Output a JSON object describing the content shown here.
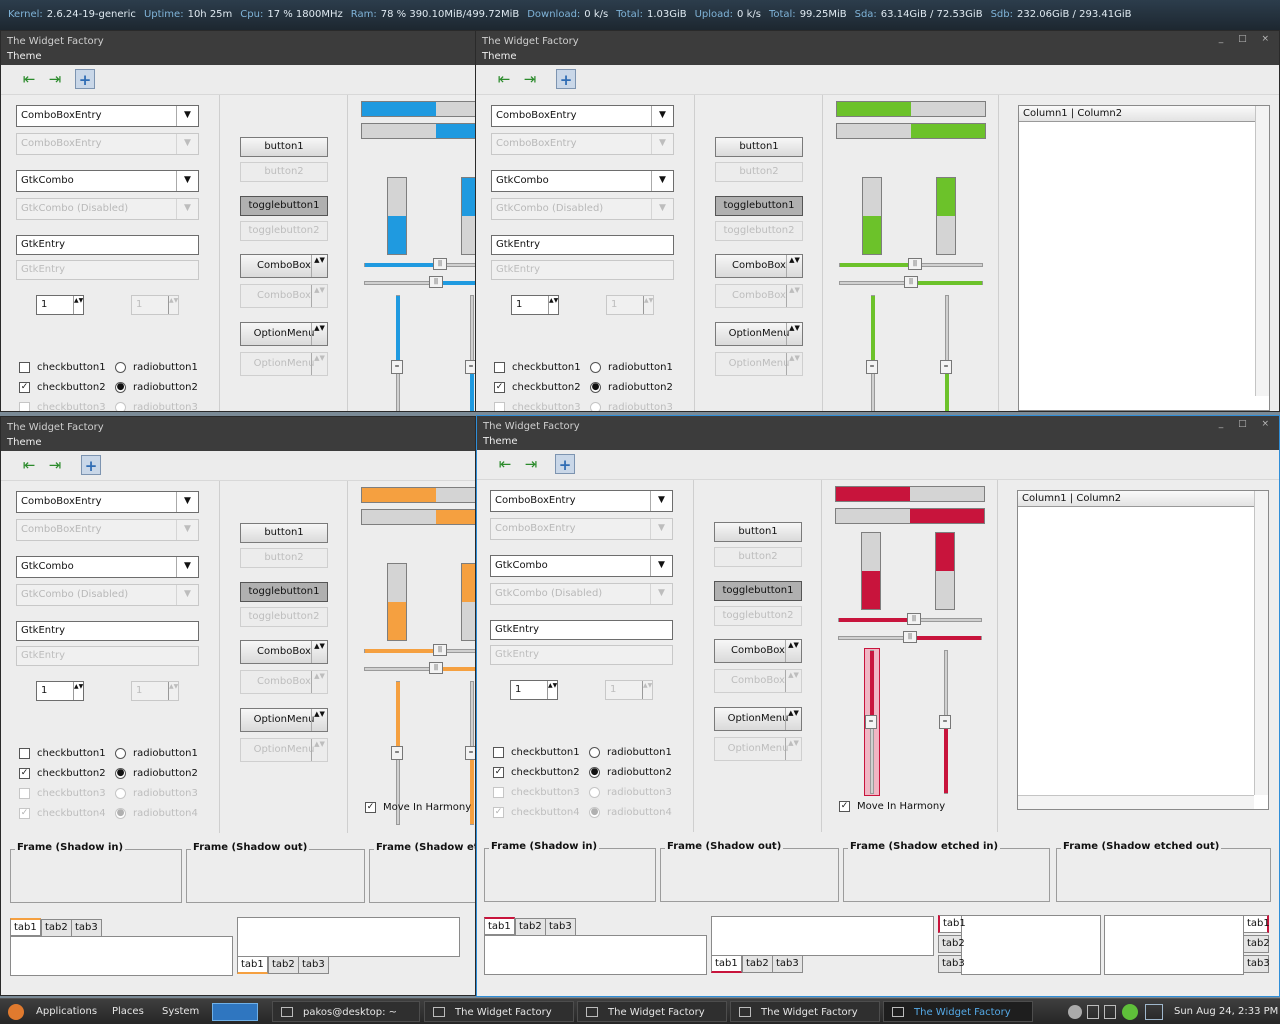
{
  "conky": [
    {
      "label": "Kernel:",
      "value": "2.6.24-19-generic"
    },
    {
      "label": "Uptime:",
      "value": "10h 25m"
    },
    {
      "label": "Cpu:",
      "value": "17 % 1800MHz"
    },
    {
      "label": "Ram:",
      "value": "78 %  390.10MiB/499.72MiB"
    },
    {
      "label": "Download:",
      "value": "0   k/s"
    },
    {
      "label": "Total:",
      "value": "1.03GiB"
    },
    {
      "label": "Upload:",
      "value": "0   k/s"
    },
    {
      "label": "Total:",
      "value": "99.25MiB"
    },
    {
      "label": "Sda:",
      "value": "63.14GiB  / 72.53GiB"
    },
    {
      "label": "Sdb:",
      "value": "232.06GiB / 293.41GiB"
    }
  ],
  "app": {
    "title": "The Widget Factory",
    "menu": "Theme",
    "window_buttons": "_ □ ×"
  },
  "w": {
    "combo_entry": "ComboBoxEntry",
    "gtk_combo": "GtkCombo",
    "gtk_combo_disabled": "GtkCombo (Disabled)",
    "entry": "GtkEntry",
    "spin_value": "1",
    "check1": "checkbutton1",
    "check2": "checkbutton2",
    "check3": "checkbutton3",
    "check4": "checkbutton4",
    "radio1": "radiobutton1",
    "radio2": "radiobutton2",
    "radio3": "radiobutton3",
    "radio4": "radiobutton4",
    "button1": "button1",
    "button2": "button2",
    "toggle1": "togglebutton1",
    "toggle2": "togglebutton2",
    "combobox": "ComboBox",
    "optionmenu": "OptionMenu",
    "col1": "Column1",
    "col2": "Column2",
    "harmony": "Move In Harmony",
    "frame_in": "Frame (Shadow in)",
    "frame_out": "Frame (Shadow out)",
    "frame_etched_in": "Frame (Shadow etched in)",
    "frame_etched_out": "Frame (Shadow etched out)",
    "frame_etched_trunc": "Frame (Shadow etche",
    "tab1": "tab1",
    "tab2": "tab2",
    "tab3": "tab3",
    "check": "✓",
    "radio_dot": "●",
    "arrow": "▼",
    "updown": "▲▼"
  },
  "accents": {
    "blue": "#1f9ae0",
    "green": "#6cc22a",
    "orange": "#f5a040",
    "red": "#c8143c"
  },
  "panel": {
    "menus": [
      "Applications",
      "Places",
      "System"
    ],
    "terminal": "pakos@desktop: ~",
    "tasks": [
      "The Widget Factory",
      "The Widget Factory",
      "The Widget Factory",
      "The Widget Factory"
    ],
    "clock": "Sun Aug 24,  2:33 PM"
  }
}
